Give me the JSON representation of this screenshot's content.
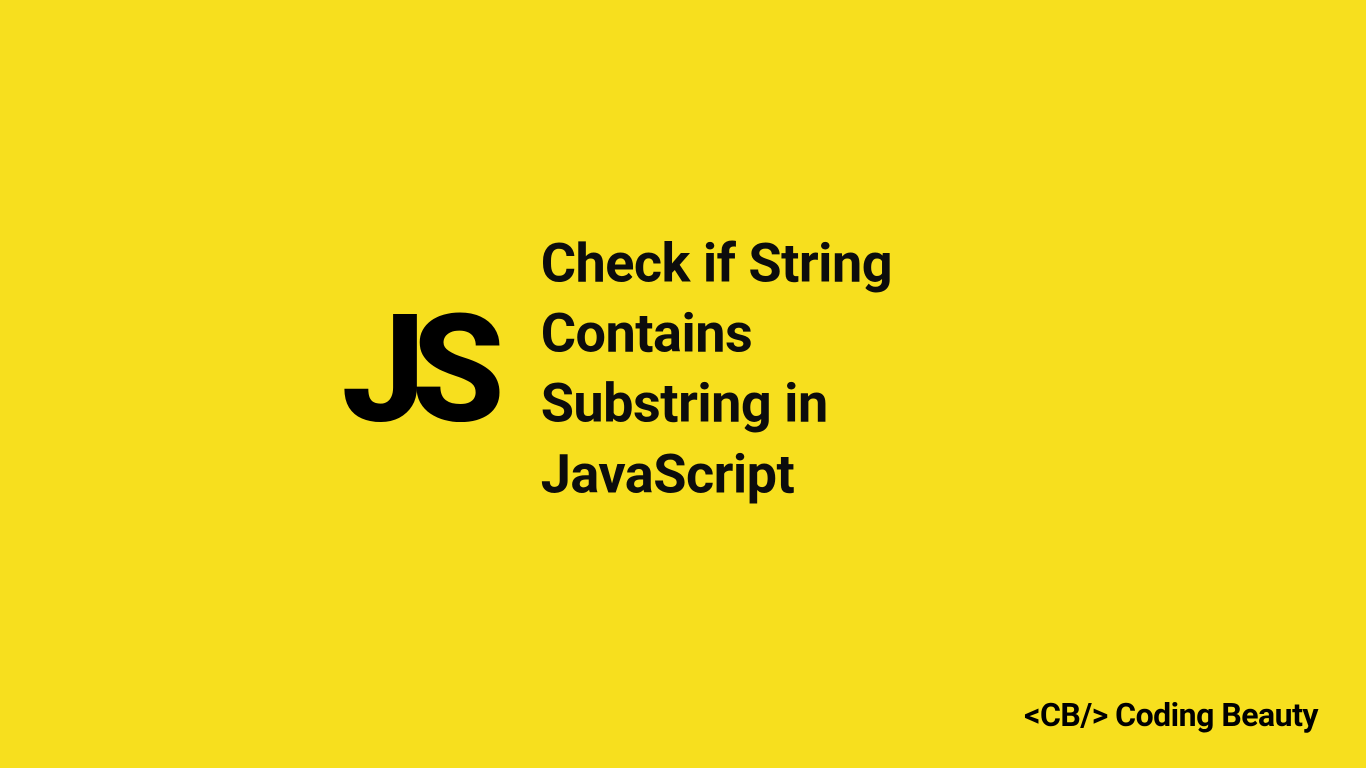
{
  "badge": {
    "text": "JS"
  },
  "title": {
    "line1": "Check if String Contains",
    "line2": "Substring in JavaScript"
  },
  "brand": {
    "text": "<CB/> Coding Beauty"
  },
  "colors": {
    "background": "#f7df1e",
    "text": "#000000"
  }
}
